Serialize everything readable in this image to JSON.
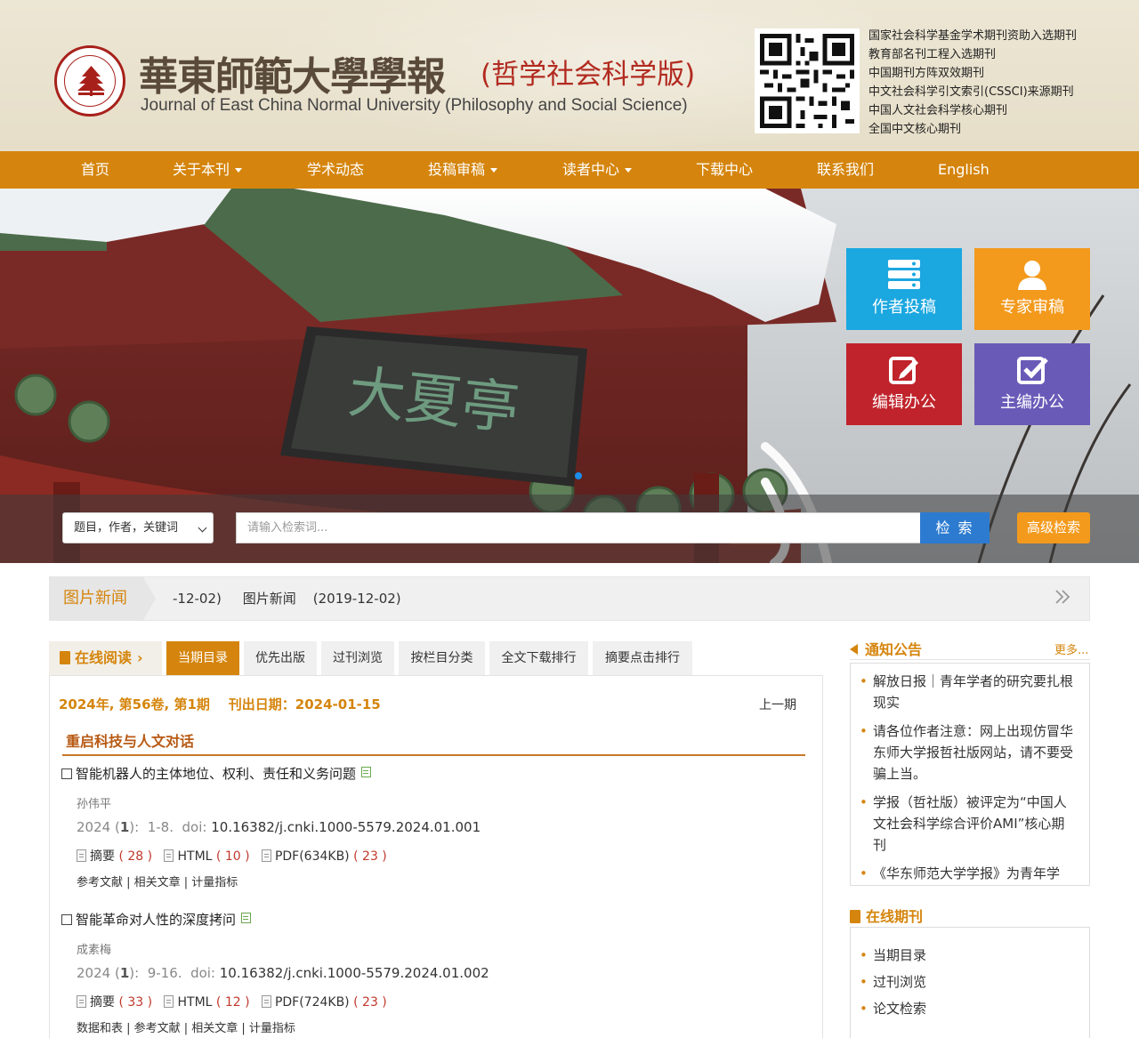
{
  "header": {
    "title_cn": "華東師範大學學報",
    "title_sub": "(哲学社会科学版)",
    "title_en": "Journal of East China Normal University (Philosophy and Social Science)",
    "honors": [
      "国家社会科学基金学术期刊资助入选期刊",
      "教育部名刊工程入选期刊",
      "中国期刊方阵双效期刊",
      "中文社会科学引文索引(CSSCI)来源期刊",
      "中国人文社会科学核心期刊",
      "全国中文核心期刊"
    ]
  },
  "nav": {
    "items": [
      {
        "label": "首页",
        "dropdown": false
      },
      {
        "label": "关于本刊",
        "dropdown": true
      },
      {
        "label": "学术动态",
        "dropdown": false
      },
      {
        "label": "投稿审稿",
        "dropdown": true
      },
      {
        "label": "读者中心",
        "dropdown": true
      },
      {
        "label": "下载中心",
        "dropdown": false
      },
      {
        "label": "联系我们",
        "dropdown": false
      },
      {
        "label": "English",
        "dropdown": false
      }
    ]
  },
  "banner": {
    "plaque_text": "大夏亭",
    "tiles": [
      {
        "label": "作者投稿",
        "icon": "server-stack-icon",
        "color": "#1ba7e0"
      },
      {
        "label": "专家审稿",
        "icon": "user-icon",
        "color": "#f39a1d"
      },
      {
        "label": "编辑办公",
        "icon": "edit-icon",
        "color": "#c0232b"
      },
      {
        "label": "主编办公",
        "icon": "check-box-icon",
        "color": "#6a5ab8"
      }
    ]
  },
  "search": {
    "field_select": "题目，作者，关键词",
    "placeholder": "请输入检索词...",
    "button": "检 索",
    "advanced": "高级检索"
  },
  "photo_news": {
    "label": "图片新闻",
    "ticker": "-12-02)     图片新闻    (2019-12-02)"
  },
  "tabs": {
    "online_reading": "在线阅读",
    "items": [
      "当期目录",
      "优先出版",
      "过刊浏览",
      "按栏目分类",
      "全文下载排行",
      "摘要点击排行"
    ],
    "active_index": 0
  },
  "issue": {
    "info": "2024年, 第56卷, 第1期    刊出日期：2024-01-15",
    "prev": "上一期",
    "section": "重启科技与人文对话"
  },
  "articles": [
    {
      "title": "智能机器人的主体地位、权利、责任和义务问题",
      "author": "孙伟平",
      "year": "2024",
      "issue": "1",
      "pages": "1-8.",
      "doi_label": "doi:",
      "doi": "10.16382/j.cnki.1000-5579.2024.01.001",
      "abstract_label": "摘要",
      "abstract_count": "28",
      "html_label": "HTML",
      "html_count": "10",
      "pdf_label": "PDF(634KB)",
      "pdf_count": "23",
      "sublinks": "参考文献 | 相关文章 | 计量指标"
    },
    {
      "title": "智能革命对人性的深度拷问",
      "author": "成素梅",
      "year": "2024",
      "issue": "1",
      "pages": "9-16.",
      "doi_label": "doi:",
      "doi": "10.16382/j.cnki.1000-5579.2024.01.002",
      "abstract_label": "摘要",
      "abstract_count": "33",
      "html_label": "HTML",
      "html_count": "12",
      "pdf_label": "PDF(724KB)",
      "pdf_count": "23",
      "sublinks": "数据和表 | 参考文献 | 相关文章 | 计量指标"
    }
  ],
  "sidebar": {
    "notice_title": "通知公告",
    "more": "更多...",
    "notices": [
      "解放日报｜青年学者的研究要扎根现实",
      "请各位作者注意：网上出现仿冒华东师大学报哲社版网站，请不要受骗上当。",
      "学报（哲社版）被评定为“中国人文社会科学综合评价AMI”核心期刊",
      "《华东师范大学学报》为青年学"
    ],
    "journal_title": "在线期刊",
    "journal_links": [
      "当期目录",
      "过刊浏览",
      "论文检索"
    ]
  },
  "colors": {
    "brand_orange": "#d5850d",
    "search_blue": "#2c7bd0",
    "advanced_orange": "#f39a1d",
    "seal_red": "#a8201a"
  }
}
